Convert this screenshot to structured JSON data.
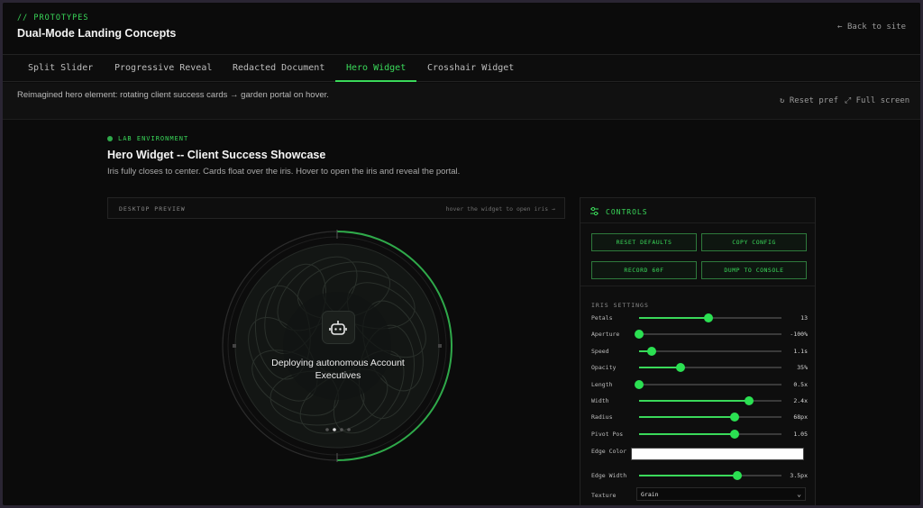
{
  "header": {
    "kicker": "// PROTOTYPES",
    "title": "Dual-Mode Landing Concepts",
    "back_link": "← Back to site"
  },
  "tabs": [
    {
      "label": "Split Slider",
      "active": false
    },
    {
      "label": "Progressive Reveal",
      "active": false
    },
    {
      "label": "Redacted Document",
      "active": false
    },
    {
      "label": "Hero Widget",
      "active": true
    },
    {
      "label": "Crosshair Widget",
      "active": false
    }
  ],
  "description": {
    "text": "Reimagined hero element: rotating client success cards → garden portal on hover.",
    "reset_pref": "Reset pref",
    "full_screen": "Full screen"
  },
  "section": {
    "badge": "LAB ENVIRONMENT",
    "title": "Hero Widget -- Client Success Showcase",
    "subtitle": "Iris fully closes to center. Cards float over the iris. Hover to open the iris and reveal the portal."
  },
  "preview": {
    "label": "DESKTOP PREVIEW",
    "hint": "hover the widget to open iris →",
    "card_text": "Deploying autonomous Account Executives",
    "card_icon": "robot-icon",
    "carousel": {
      "count": 4,
      "active_index": 1
    },
    "accent": "#3ad95a"
  },
  "controls": {
    "title": "CONTROLS",
    "buttons": [
      "RESET DEFAULTS",
      "COPY CONFIG",
      "RECORD 60F",
      "DUMP TO CONSOLE"
    ],
    "section_label": "IRIS SETTINGS",
    "sliders": [
      {
        "label": "Petals",
        "value": "13",
        "level": 0.49
      },
      {
        "label": "Aperture",
        "value": "-100%",
        "level": 0.0
      },
      {
        "label": "Speed",
        "value": "1.1s",
        "level": 0.09
      },
      {
        "label": "Opacity",
        "value": "35%",
        "level": 0.29
      },
      {
        "label": "Length",
        "value": "0.5x",
        "level": 0.0
      },
      {
        "label": "Width",
        "value": "2.4x",
        "level": 0.77
      },
      {
        "label": "Radius",
        "value": "68px",
        "level": 0.67
      },
      {
        "label": "Pivot Pos",
        "value": "1.05",
        "level": 0.67
      }
    ],
    "edge_color": {
      "label": "Edge Color",
      "value": "#ffffff"
    },
    "edge_width": {
      "label": "Edge Width",
      "value": "3.5px",
      "level": 0.69
    },
    "texture": {
      "label": "Texture",
      "value": "Grain"
    }
  },
  "colors": {
    "accent": "#3ad95a",
    "background": "#0b0b0b",
    "frame": "#2a2533"
  }
}
